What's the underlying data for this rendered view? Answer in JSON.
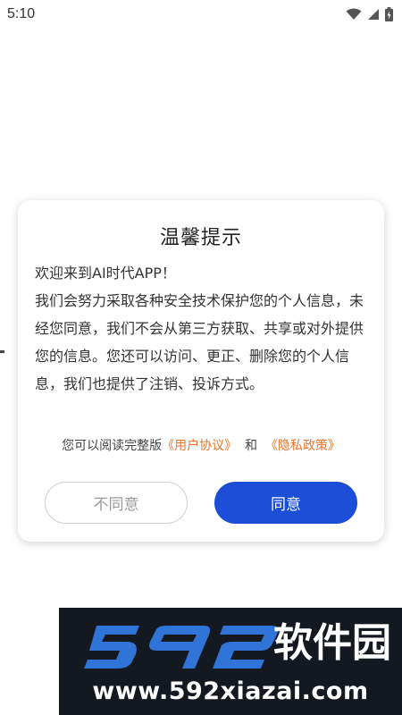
{
  "status_bar": {
    "time": "5:10"
  },
  "dialog": {
    "title": "温馨提示",
    "body_lines": [
      "欢迎来到AI时代APP！",
      "我们会努力采取各种安全技术保护您的个人信息，未经您同意，我们不会从第三方获取、共享或对外提供您的信息。您还可以访问、更正、删除您的个人信息，我们也提供了注销、投诉方式。"
    ],
    "links_prefix": "您可以阅读完整版",
    "user_agreement": "《用户协议》",
    "connector": "和",
    "privacy_policy": "《隐私政策》",
    "disagree_label": "不同意",
    "agree_label": "同意"
  },
  "watermark": {
    "brand": "592软件园",
    "url": "www.592xiazai.com"
  },
  "colors": {
    "link": "#e8742c",
    "agree_button": "#1c4ed8",
    "watermark_blue": "#2f74d6",
    "watermark_bg": "#141820"
  },
  "icons": [
    "wifi-icon",
    "signal-icon",
    "battery-icon"
  ]
}
